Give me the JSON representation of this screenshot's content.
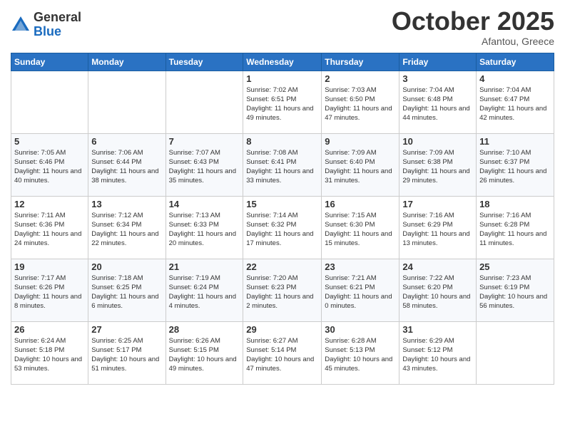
{
  "logo": {
    "general": "General",
    "blue": "Blue"
  },
  "header": {
    "month": "October 2025",
    "location": "Afantou, Greece"
  },
  "days_of_week": [
    "Sunday",
    "Monday",
    "Tuesday",
    "Wednesday",
    "Thursday",
    "Friday",
    "Saturday"
  ],
  "weeks": [
    [
      {
        "day": "",
        "info": ""
      },
      {
        "day": "",
        "info": ""
      },
      {
        "day": "",
        "info": ""
      },
      {
        "day": "1",
        "info": "Sunrise: 7:02 AM\nSunset: 6:51 PM\nDaylight: 11 hours and 49 minutes."
      },
      {
        "day": "2",
        "info": "Sunrise: 7:03 AM\nSunset: 6:50 PM\nDaylight: 11 hours and 47 minutes."
      },
      {
        "day": "3",
        "info": "Sunrise: 7:04 AM\nSunset: 6:48 PM\nDaylight: 11 hours and 44 minutes."
      },
      {
        "day": "4",
        "info": "Sunrise: 7:04 AM\nSunset: 6:47 PM\nDaylight: 11 hours and 42 minutes."
      }
    ],
    [
      {
        "day": "5",
        "info": "Sunrise: 7:05 AM\nSunset: 6:46 PM\nDaylight: 11 hours and 40 minutes."
      },
      {
        "day": "6",
        "info": "Sunrise: 7:06 AM\nSunset: 6:44 PM\nDaylight: 11 hours and 38 minutes."
      },
      {
        "day": "7",
        "info": "Sunrise: 7:07 AM\nSunset: 6:43 PM\nDaylight: 11 hours and 35 minutes."
      },
      {
        "day": "8",
        "info": "Sunrise: 7:08 AM\nSunset: 6:41 PM\nDaylight: 11 hours and 33 minutes."
      },
      {
        "day": "9",
        "info": "Sunrise: 7:09 AM\nSunset: 6:40 PM\nDaylight: 11 hours and 31 minutes."
      },
      {
        "day": "10",
        "info": "Sunrise: 7:09 AM\nSunset: 6:38 PM\nDaylight: 11 hours and 29 minutes."
      },
      {
        "day": "11",
        "info": "Sunrise: 7:10 AM\nSunset: 6:37 PM\nDaylight: 11 hours and 26 minutes."
      }
    ],
    [
      {
        "day": "12",
        "info": "Sunrise: 7:11 AM\nSunset: 6:36 PM\nDaylight: 11 hours and 24 minutes."
      },
      {
        "day": "13",
        "info": "Sunrise: 7:12 AM\nSunset: 6:34 PM\nDaylight: 11 hours and 22 minutes."
      },
      {
        "day": "14",
        "info": "Sunrise: 7:13 AM\nSunset: 6:33 PM\nDaylight: 11 hours and 20 minutes."
      },
      {
        "day": "15",
        "info": "Sunrise: 7:14 AM\nSunset: 6:32 PM\nDaylight: 11 hours and 17 minutes."
      },
      {
        "day": "16",
        "info": "Sunrise: 7:15 AM\nSunset: 6:30 PM\nDaylight: 11 hours and 15 minutes."
      },
      {
        "day": "17",
        "info": "Sunrise: 7:16 AM\nSunset: 6:29 PM\nDaylight: 11 hours and 13 minutes."
      },
      {
        "day": "18",
        "info": "Sunrise: 7:16 AM\nSunset: 6:28 PM\nDaylight: 11 hours and 11 minutes."
      }
    ],
    [
      {
        "day": "19",
        "info": "Sunrise: 7:17 AM\nSunset: 6:26 PM\nDaylight: 11 hours and 8 minutes."
      },
      {
        "day": "20",
        "info": "Sunrise: 7:18 AM\nSunset: 6:25 PM\nDaylight: 11 hours and 6 minutes."
      },
      {
        "day": "21",
        "info": "Sunrise: 7:19 AM\nSunset: 6:24 PM\nDaylight: 11 hours and 4 minutes."
      },
      {
        "day": "22",
        "info": "Sunrise: 7:20 AM\nSunset: 6:23 PM\nDaylight: 11 hours and 2 minutes."
      },
      {
        "day": "23",
        "info": "Sunrise: 7:21 AM\nSunset: 6:21 PM\nDaylight: 11 hours and 0 minutes."
      },
      {
        "day": "24",
        "info": "Sunrise: 7:22 AM\nSunset: 6:20 PM\nDaylight: 10 hours and 58 minutes."
      },
      {
        "day": "25",
        "info": "Sunrise: 7:23 AM\nSunset: 6:19 PM\nDaylight: 10 hours and 56 minutes."
      }
    ],
    [
      {
        "day": "26",
        "info": "Sunrise: 6:24 AM\nSunset: 5:18 PM\nDaylight: 10 hours and 53 minutes."
      },
      {
        "day": "27",
        "info": "Sunrise: 6:25 AM\nSunset: 5:17 PM\nDaylight: 10 hours and 51 minutes."
      },
      {
        "day": "28",
        "info": "Sunrise: 6:26 AM\nSunset: 5:15 PM\nDaylight: 10 hours and 49 minutes."
      },
      {
        "day": "29",
        "info": "Sunrise: 6:27 AM\nSunset: 5:14 PM\nDaylight: 10 hours and 47 minutes."
      },
      {
        "day": "30",
        "info": "Sunrise: 6:28 AM\nSunset: 5:13 PM\nDaylight: 10 hours and 45 minutes."
      },
      {
        "day": "31",
        "info": "Sunrise: 6:29 AM\nSunset: 5:12 PM\nDaylight: 10 hours and 43 minutes."
      },
      {
        "day": "",
        "info": ""
      }
    ]
  ]
}
